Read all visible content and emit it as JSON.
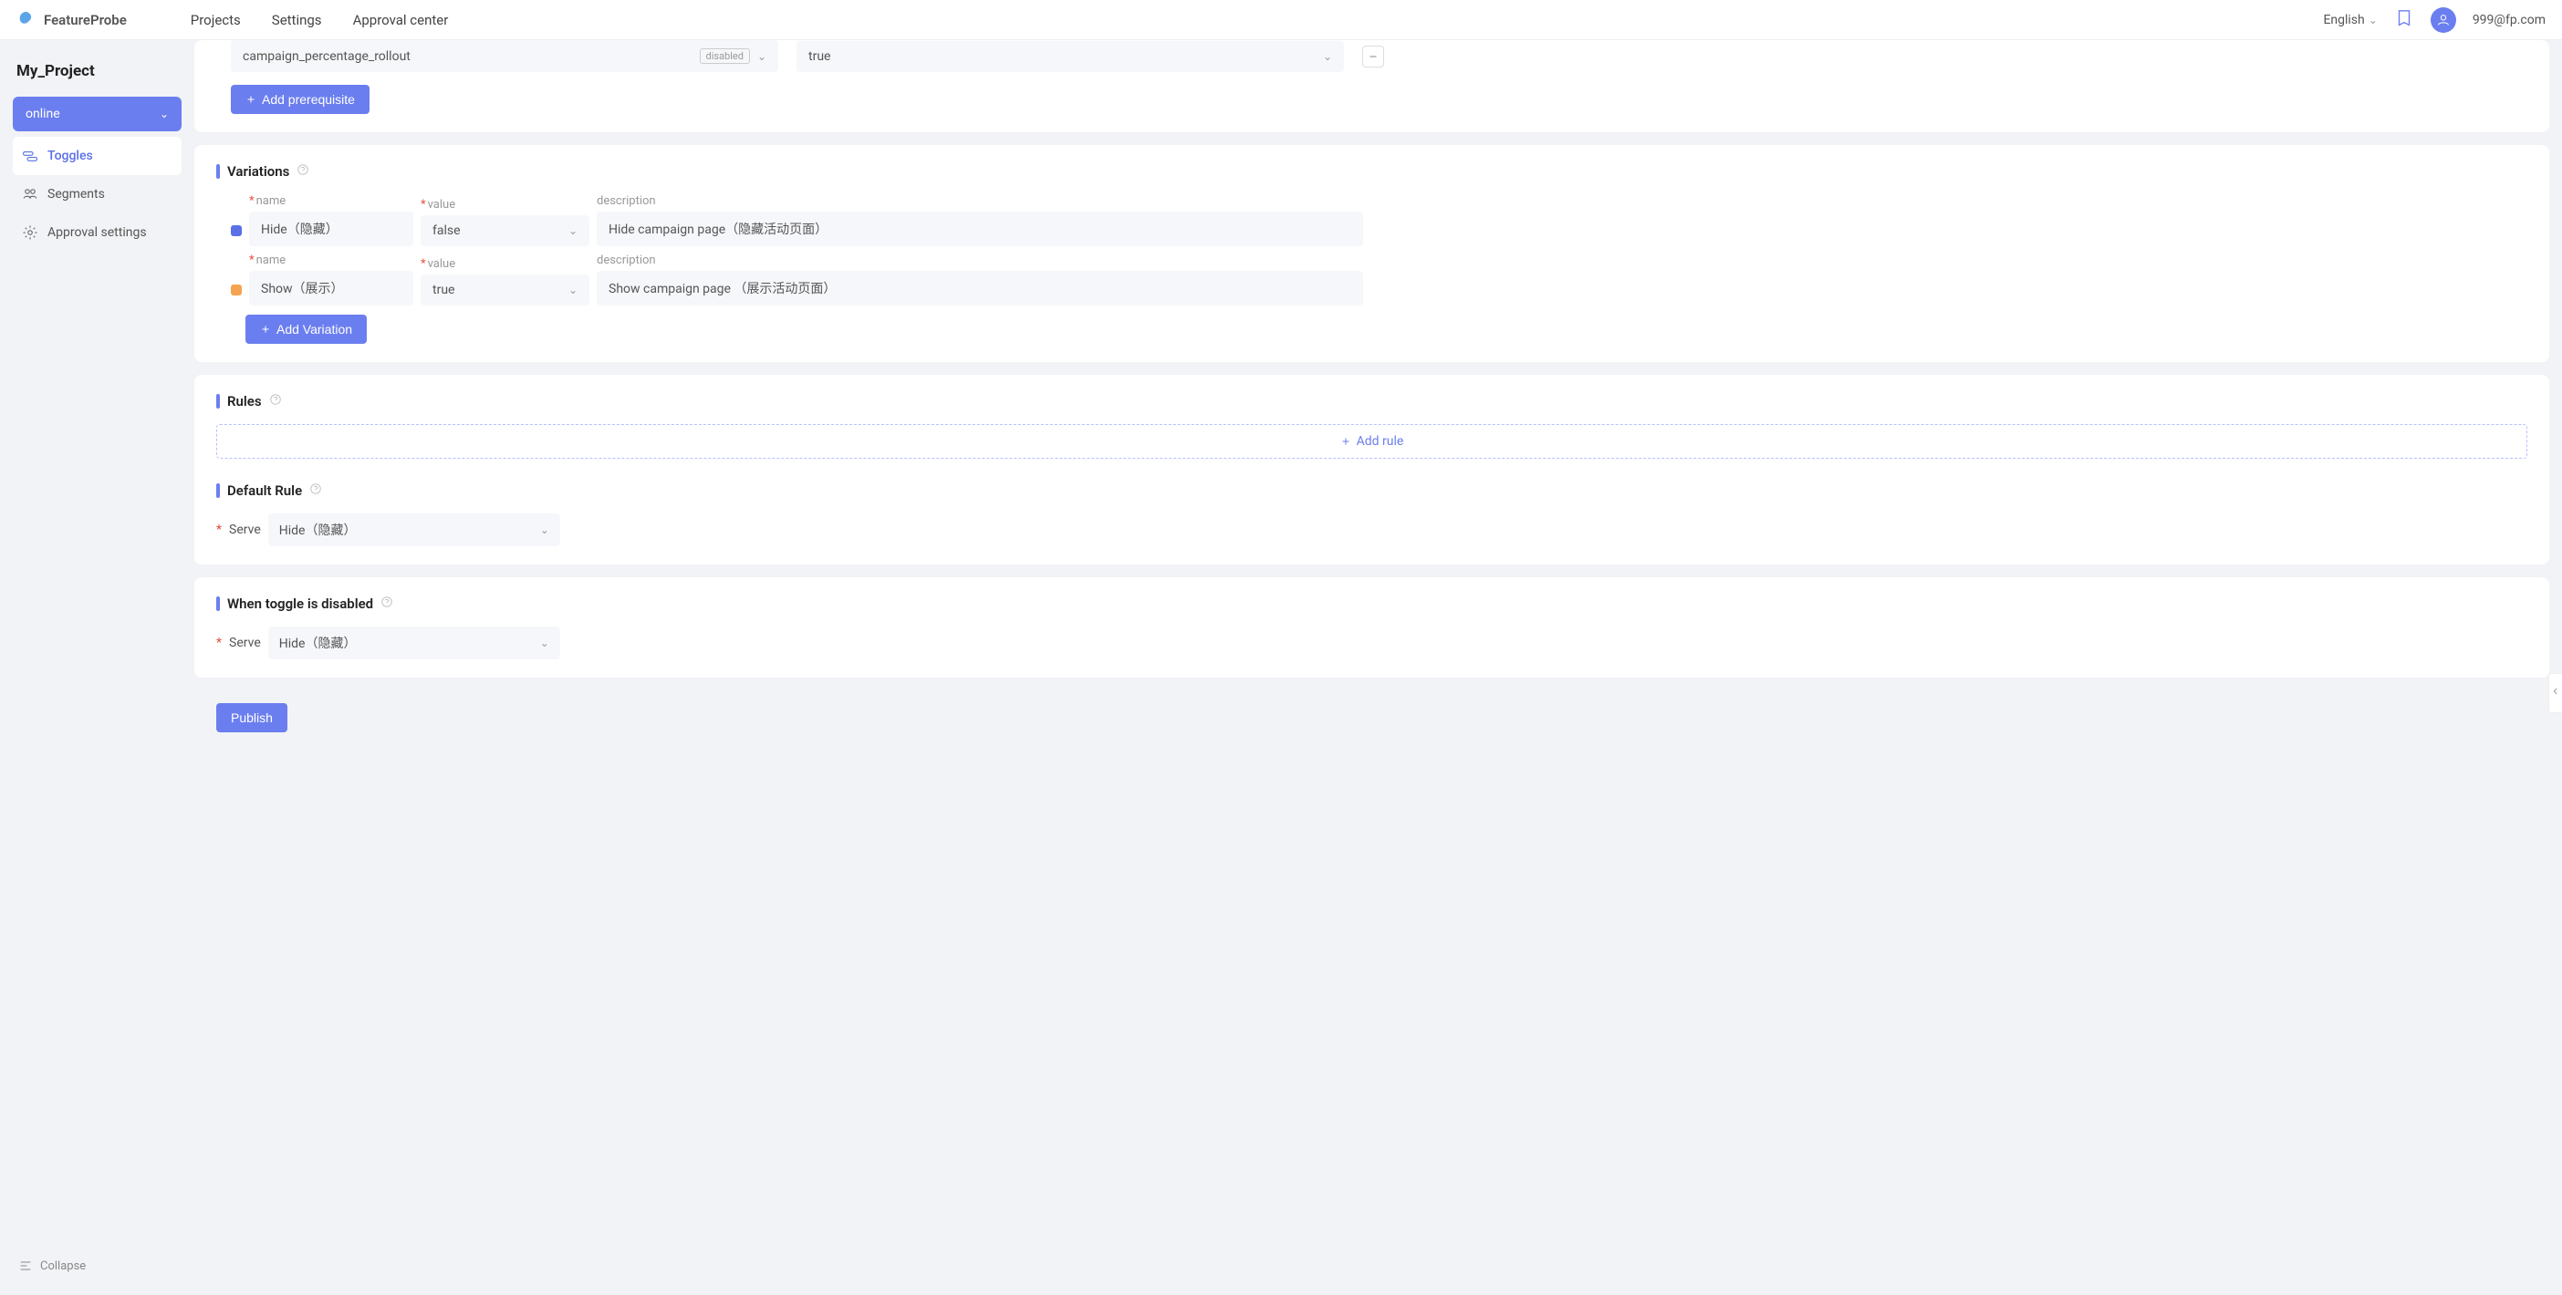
{
  "header": {
    "logo_text": "FeatureProbe",
    "nav": {
      "projects": "Projects",
      "settings": "Settings",
      "approval_center": "Approval center"
    },
    "language": "English",
    "user_email": "999@fp.com"
  },
  "sidebar": {
    "project_name": "My_Project",
    "environment": "online",
    "items": {
      "toggles": "Toggles",
      "segments": "Segments",
      "approval_settings": "Approval settings"
    },
    "collapse": "Collapse"
  },
  "prerequisite": {
    "toggle_key": "campaign_percentage_rollout",
    "status_badge": "disabled",
    "return_value": "true",
    "add_button": "Add prerequisite"
  },
  "variations": {
    "title": "Variations",
    "labels": {
      "name": "name",
      "value": "value",
      "description": "description"
    },
    "rows": [
      {
        "color": "blue",
        "name": "Hide（隐藏）",
        "value": "false",
        "description": "Hide campaign  page（隐藏活动页面）"
      },
      {
        "color": "orange",
        "name": "Show（展示）",
        "value": "true",
        "description": "Show campaign  page （展示活动页面）"
      }
    ],
    "add_button": "Add Variation"
  },
  "rules": {
    "title": "Rules",
    "add_button": "Add rule"
  },
  "default_rule": {
    "title": "Default Rule",
    "serve_label": "Serve",
    "serve_value": "Hide（隐藏）"
  },
  "disabled_section": {
    "title": "When toggle is disabled",
    "serve_label": "Serve",
    "serve_value": "Hide（隐藏）"
  },
  "publish": {
    "button": "Publish"
  }
}
